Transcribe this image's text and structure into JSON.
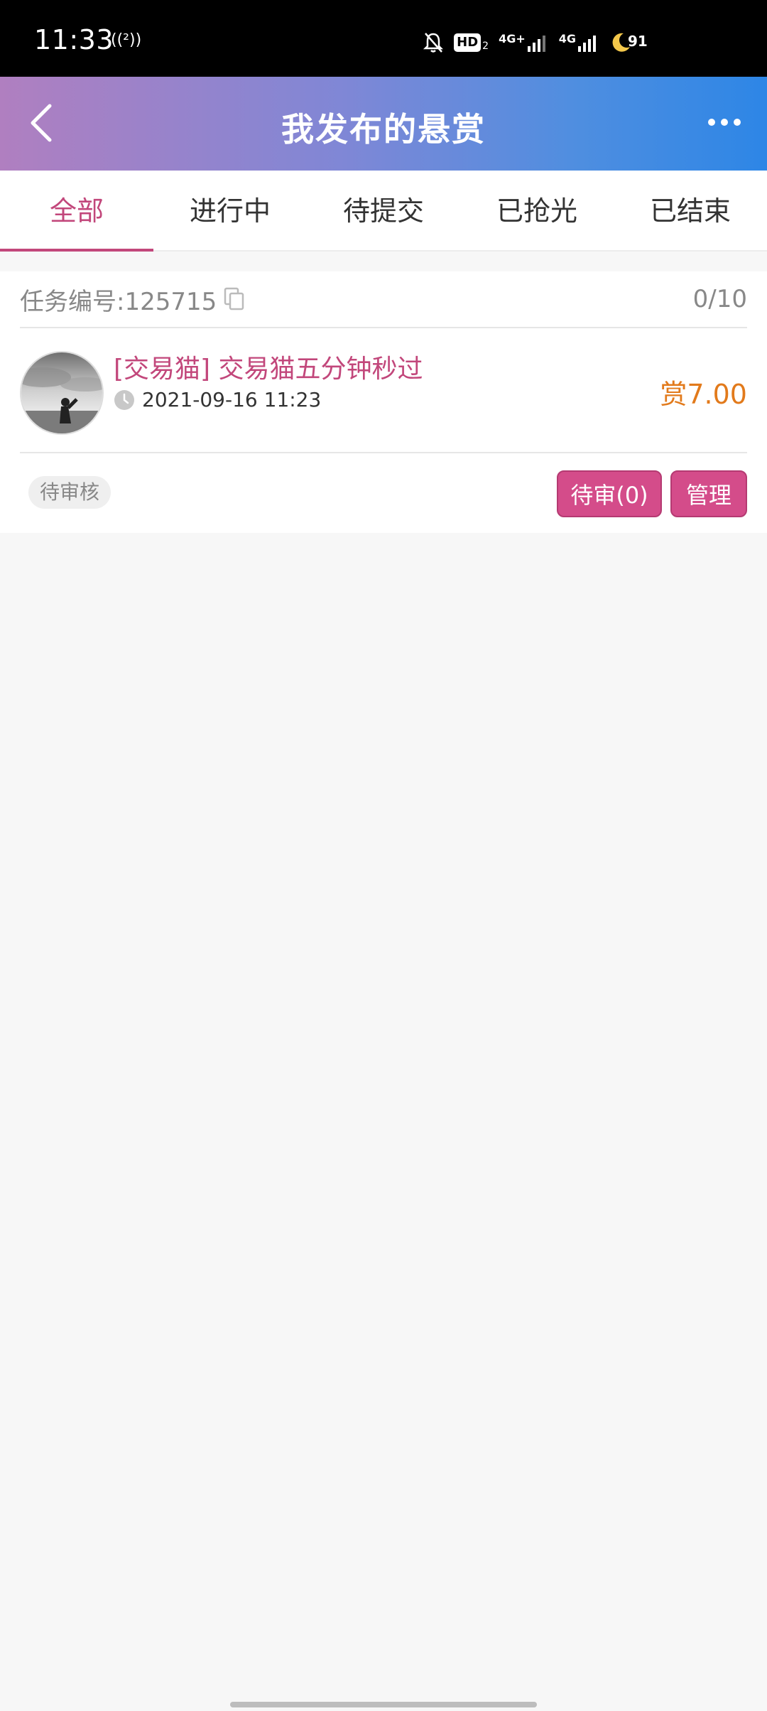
{
  "status_bar": {
    "time": "11:33",
    "nfc": "((²))",
    "hd_label": "HD",
    "sim1_label": "4G+",
    "sim2_label": "4G",
    "battery": "91"
  },
  "header": {
    "title": "我发布的悬赏"
  },
  "tabs": [
    {
      "label": "全部",
      "active": true
    },
    {
      "label": "进行中",
      "active": false
    },
    {
      "label": "待提交",
      "active": false
    },
    {
      "label": "已抢光",
      "active": false
    },
    {
      "label": "已结束",
      "active": false
    }
  ],
  "task": {
    "id_text": "任务编号:125715",
    "progress": "0/10",
    "title": "[交易猫] 交易猫五分钟秒过",
    "time": "2021-09-16 11:23",
    "reward": "赏7.00",
    "status": "待审核",
    "review_button": "待审(0)",
    "manage_button": "管理"
  },
  "colors": {
    "accent": "#c2477b",
    "button": "#d44c8a",
    "reward": "#e27a1b",
    "header_start": "#b07fc0",
    "header_end": "#2d86e6"
  }
}
